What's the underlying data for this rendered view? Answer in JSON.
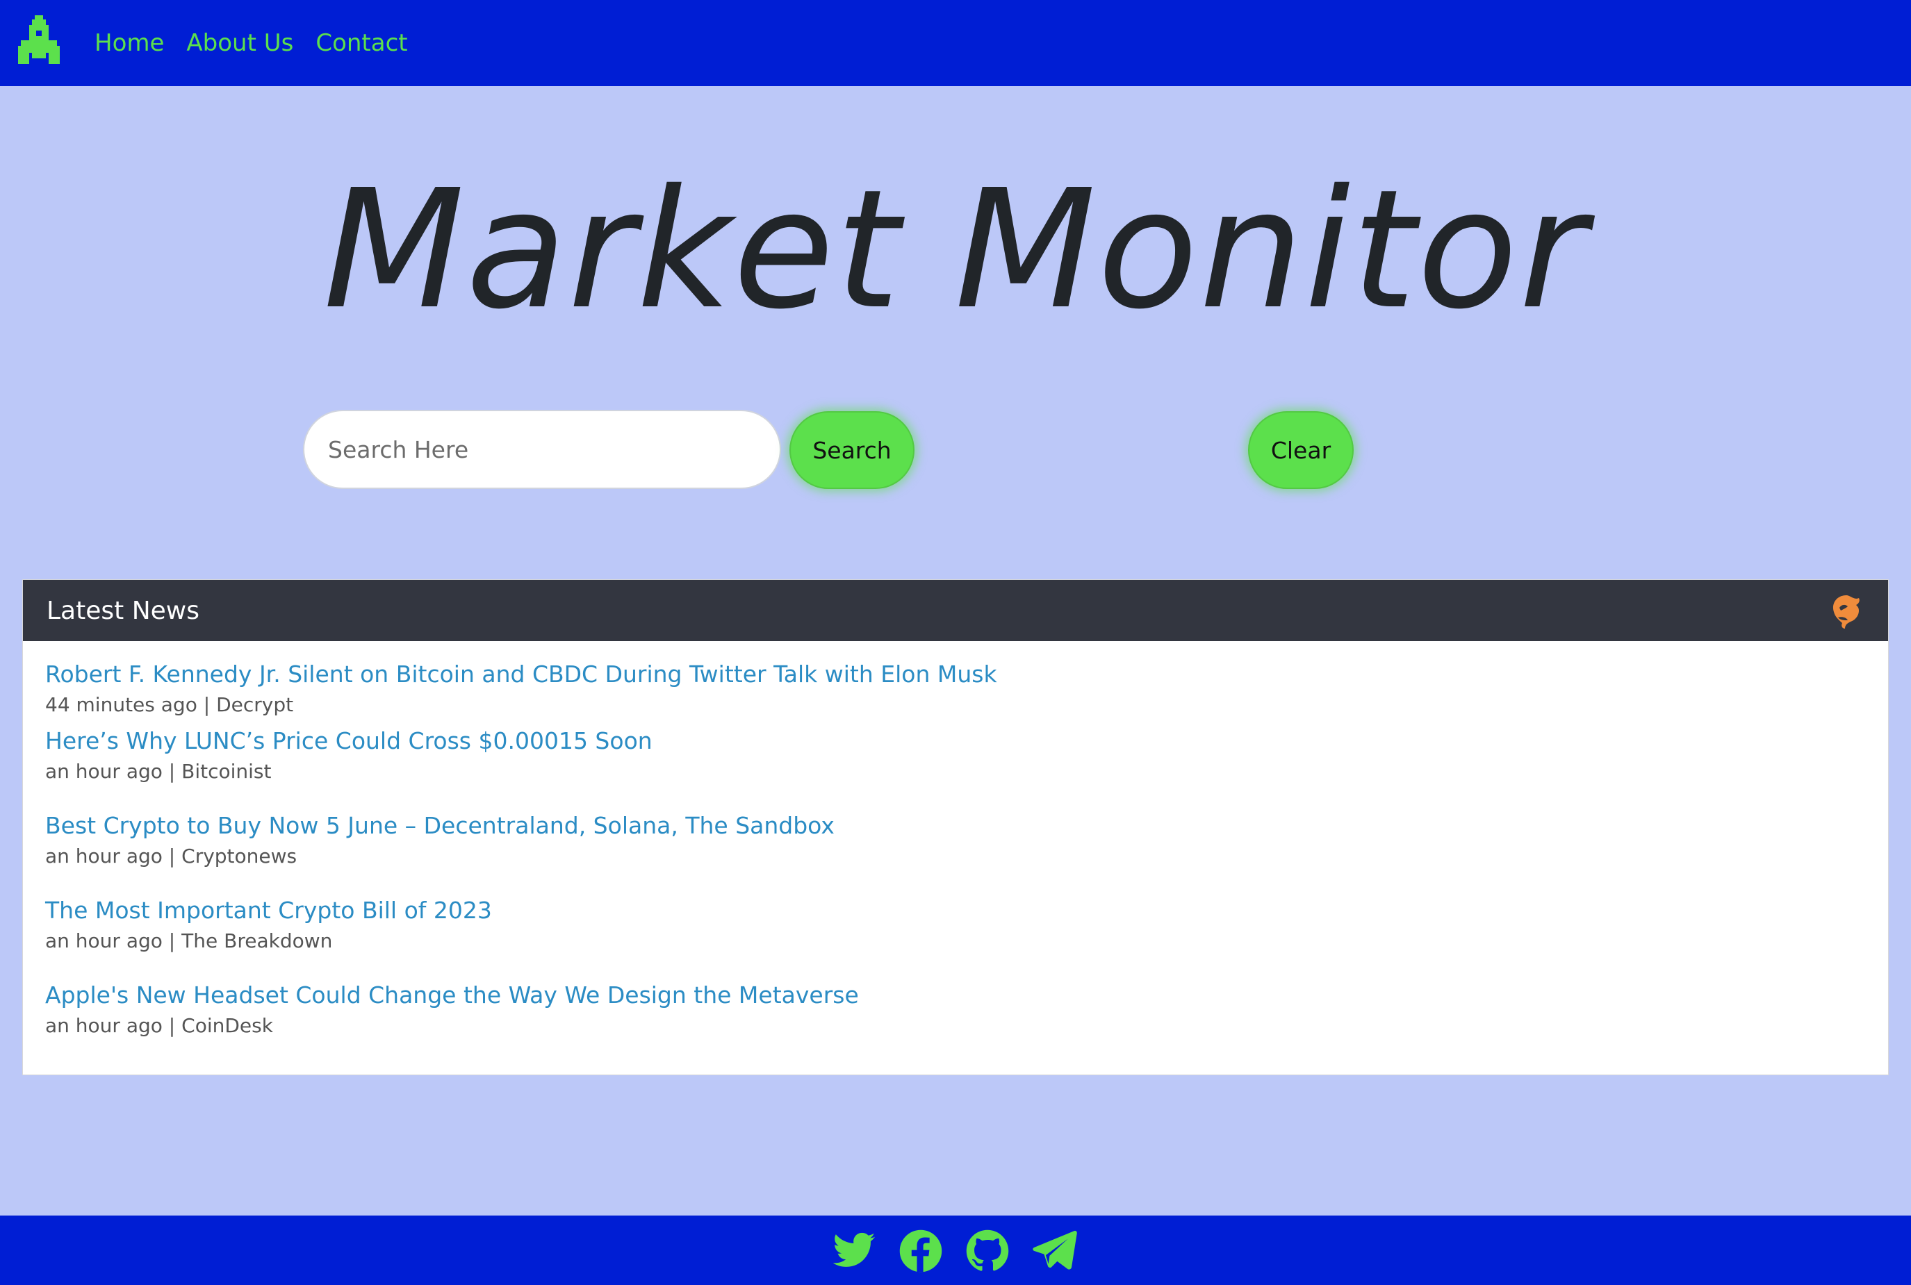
{
  "nav": {
    "logo_icon": "rocket-icon",
    "links": [
      "Home",
      "About Us",
      "Contact"
    ]
  },
  "hero": {
    "title": "Market Monitor"
  },
  "search": {
    "placeholder": "Search Here",
    "value": "",
    "search_label": "Search",
    "clear_label": "Clear"
  },
  "news": {
    "header": "Latest News",
    "header_icon": "coingecko-icon",
    "items": [
      {
        "title": "Robert F. Kennedy Jr. Silent on Bitcoin and CBDC During Twitter Talk with Elon Musk",
        "meta": "44 minutes ago | Decrypt"
      },
      {
        "title": "Here’s Why LUNC’s Price Could Cross $0.00015 Soon",
        "meta": "an hour ago | Bitcoinist"
      },
      {
        "title": "Best Crypto to Buy Now 5 June – Decentraland, Solana, The Sandbox",
        "meta": "an hour ago | Cryptonews"
      },
      {
        "title": "The Most Important Crypto Bill of 2023",
        "meta": "an hour ago | The Breakdown"
      },
      {
        "title": "Apple's New Headset Could Change the Way We Design the Metaverse",
        "meta": "an hour ago | CoinDesk"
      }
    ]
  },
  "footer": {
    "icons": [
      "twitter-icon",
      "facebook-icon",
      "github-icon",
      "telegram-icon"
    ]
  },
  "colors": {
    "nav_bg": "#001ed4",
    "accent_green": "#5ce04c",
    "page_bg": "#bcc8f8",
    "news_header_bg": "#333640",
    "link_blue": "#2b8cc4"
  }
}
